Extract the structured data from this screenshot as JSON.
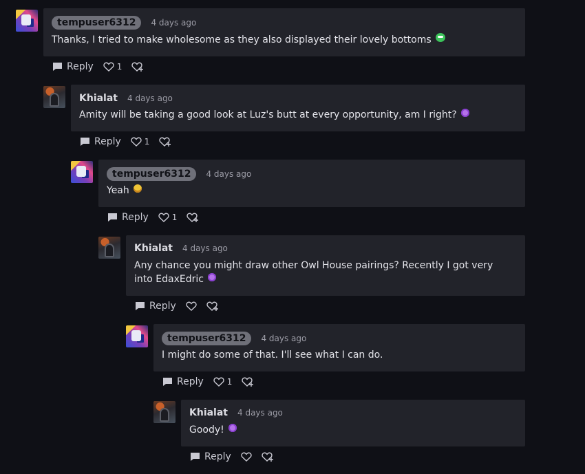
{
  "comments": [
    {
      "username": "tempuser6312",
      "pill": true,
      "avatar": "avatar-tempuser",
      "date": "4 days ago",
      "text": "Thanks, I tried to make wholesome as they also displayed their lovely bottoms",
      "emoji": "green-laughing-emoji",
      "reply_label": "Reply",
      "likes": "1"
    },
    {
      "username": "Khialat",
      "pill": false,
      "avatar": "avatar-khialat",
      "date": "4 days ago",
      "text": "Amity will be taking a good look at Luz's butt at every opportunity, am I right?",
      "emoji": "purple-smirk-emoji",
      "reply_label": "Reply",
      "likes": "1"
    },
    {
      "username": "tempuser6312",
      "pill": true,
      "avatar": "avatar-tempuser",
      "date": "4 days ago",
      "text": "Yeah",
      "emoji": "yellow-grin-emoji",
      "reply_label": "Reply",
      "likes": "1"
    },
    {
      "username": "Khialat",
      "pill": false,
      "avatar": "avatar-khialat",
      "date": "4 days ago",
      "text": "Any chance you might draw other Owl House pairings? Recently I got very into EdaxEdric",
      "emoji": "purple-smirk-emoji",
      "reply_label": "Reply",
      "likes": ""
    },
    {
      "username": "tempuser6312",
      "pill": true,
      "avatar": "avatar-tempuser",
      "date": "4 days ago",
      "text": "I might do some of that. I'll see what I can do.",
      "emoji": "",
      "reply_label": "Reply",
      "likes": "1"
    },
    {
      "username": "Khialat",
      "pill": false,
      "avatar": "avatar-khialat",
      "date": "4 days ago",
      "text": "Goody!",
      "emoji": "purple-smirk-emoji",
      "reply_label": "Reply",
      "likes": ""
    }
  ],
  "icons": {
    "reply": "speech-bubble-icon",
    "like": "heart-icon",
    "favorite": "heart-plus-icon"
  },
  "colors": {
    "background": "#0f1016",
    "card": "#22232a",
    "pill": "#6f7079",
    "text": "#e4e4ea",
    "muted": "#9c9ca6"
  }
}
